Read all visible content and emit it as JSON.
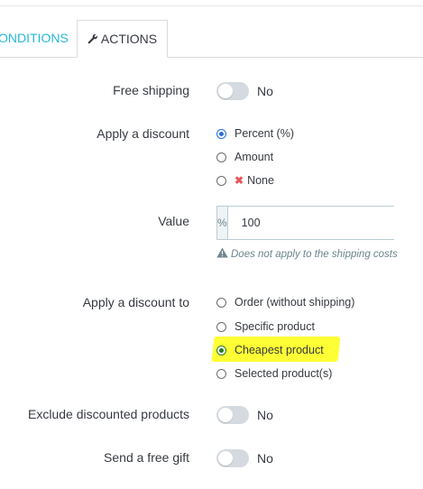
{
  "tabs": {
    "conditions": "ONDITIONS",
    "actions": "ACTIONS"
  },
  "free_shipping": {
    "label": "Free shipping",
    "state": "No"
  },
  "apply_discount": {
    "label": "Apply a discount",
    "options": [
      "Percent (%)",
      "Amount",
      "None"
    ],
    "selected": "Percent (%)"
  },
  "value": {
    "label": "Value",
    "unit": "%",
    "amount": "100",
    "help": "Does not apply to the shipping costs"
  },
  "apply_discount_to": {
    "label": "Apply a discount to",
    "options": [
      "Order (without shipping)",
      "Specific product",
      "Cheapest product",
      "Selected product(s)"
    ],
    "selected": "Cheapest product"
  },
  "exclude_discounted": {
    "label": "Exclude discounted products",
    "state": "No"
  },
  "free_gift": {
    "label": "Send a free gift",
    "state": "No"
  },
  "colors": {
    "accent": "#25b9d7",
    "highlight": "#ffff35",
    "toggle_off": "#d4dadf"
  }
}
